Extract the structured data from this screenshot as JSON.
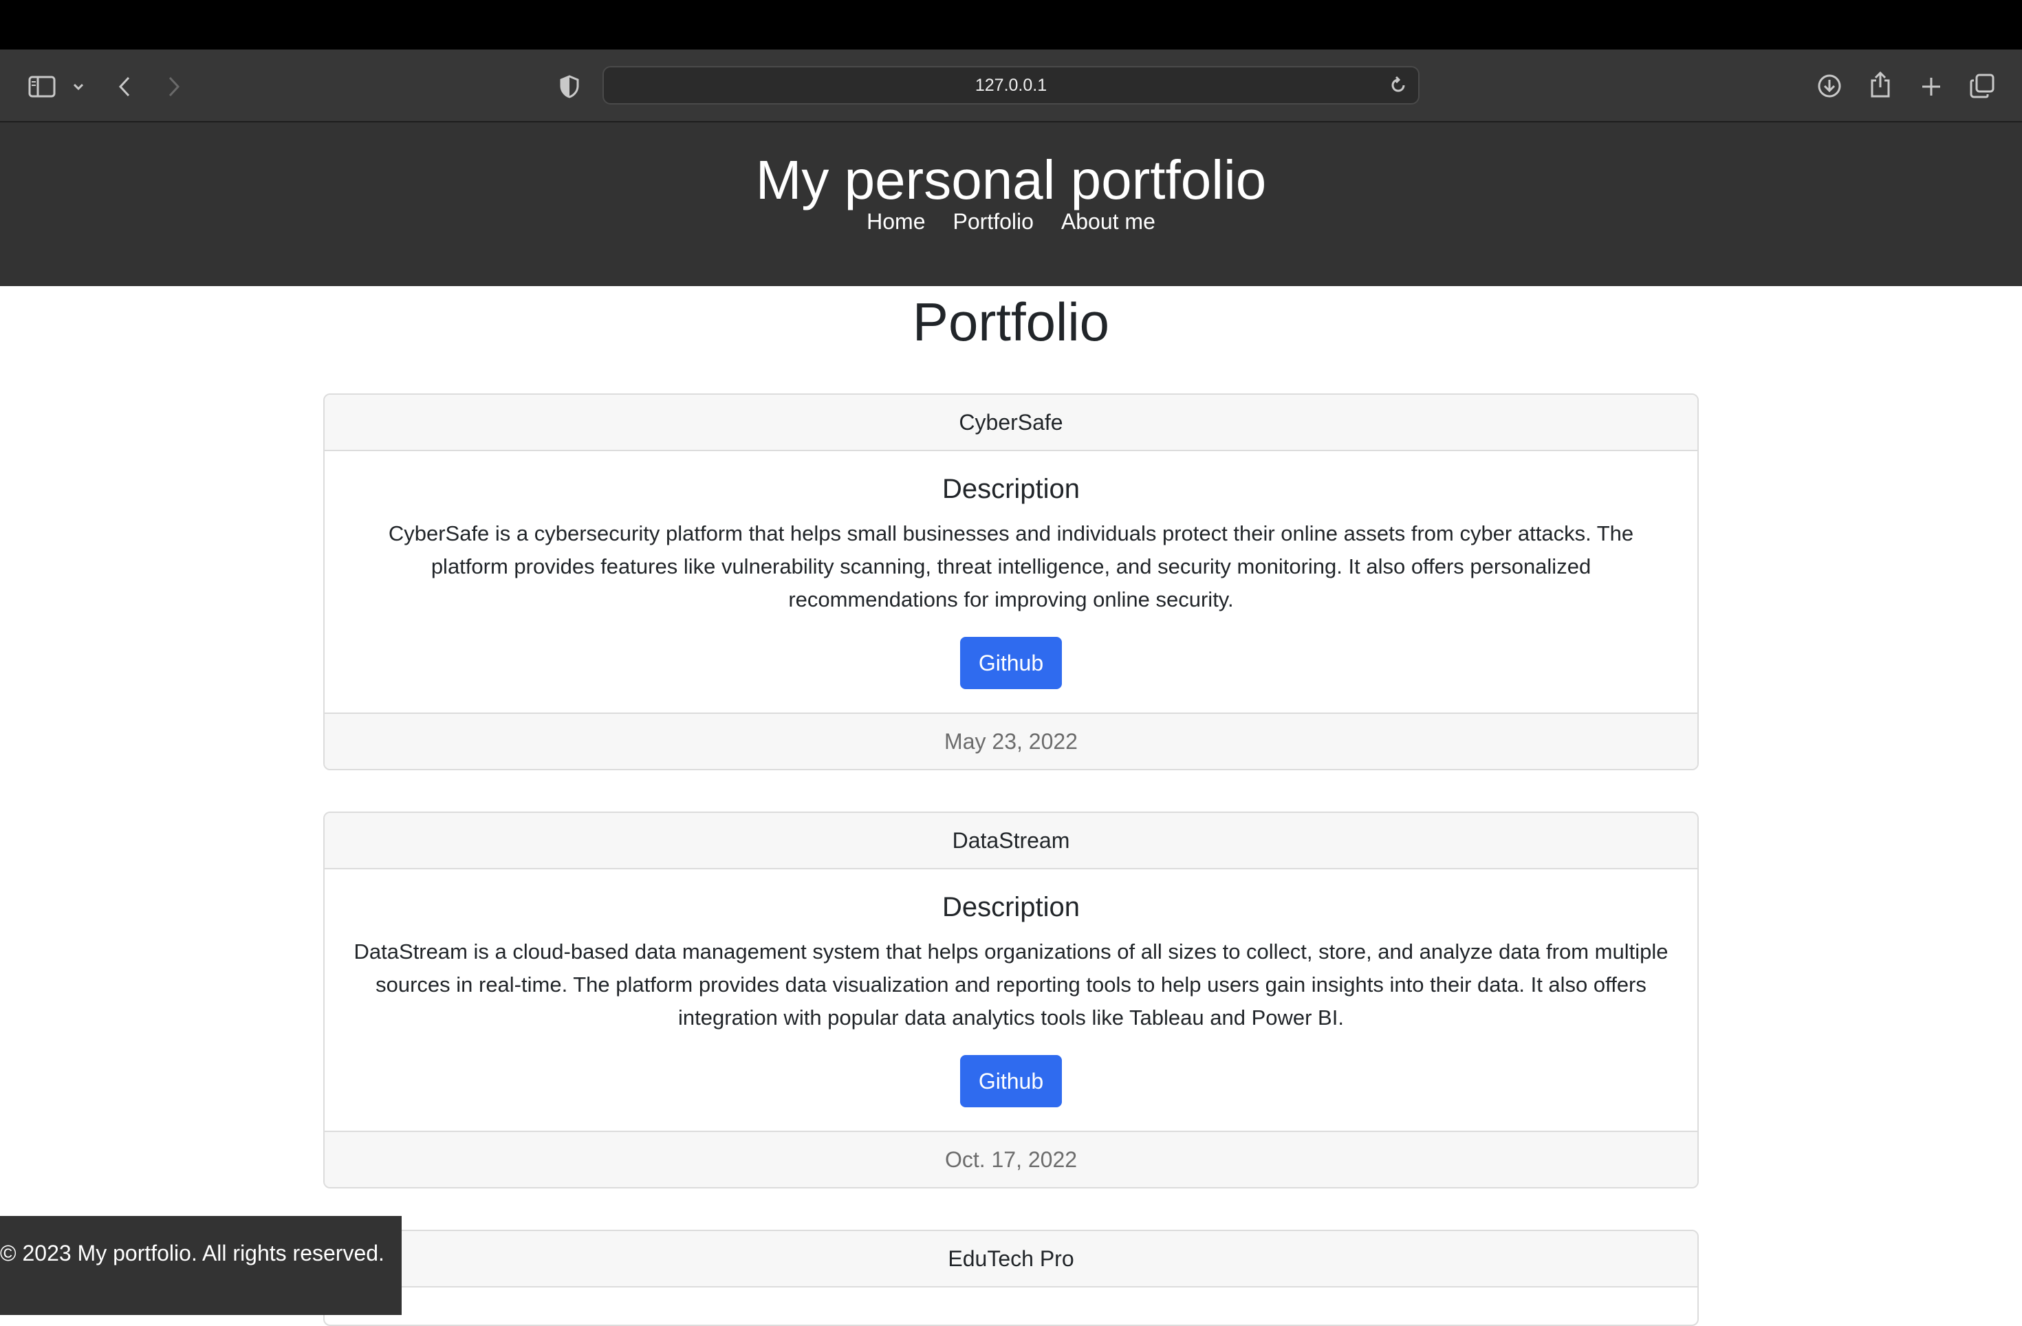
{
  "browser": {
    "url": "127.0.0.1"
  },
  "header": {
    "title": "My personal portfolio",
    "nav": [
      "Home",
      "Portfolio",
      "About me"
    ]
  },
  "main": {
    "heading": "Portfolio",
    "projects": [
      {
        "name": "CyberSafe",
        "description_heading": "Description",
        "description": "CyberSafe is a cybersecurity platform that helps small businesses and individuals protect their online assets from cyber attacks. The platform provides features like vulnerability scanning, threat intelligence, and security monitoring. It also offers personalized recommendations for improving online security.",
        "button_label": "Github",
        "date": "May 23, 2022"
      },
      {
        "name": "DataStream",
        "description_heading": "Description",
        "description": "DataStream is a cloud-based data management system that helps organizations of all sizes to collect, store, and analyze data from multiple sources in real-time. The platform provides data visualization and reporting tools to help users gain insights into their data. It also offers integration with popular data analytics tools like Tableau and Power BI.",
        "button_label": "Github",
        "date": "Oct. 17, 2022"
      },
      {
        "name": "EduTech Pro"
      }
    ]
  },
  "footer": {
    "text": "© 2023 My portfolio. All rights reserved."
  },
  "colors": {
    "header_bg": "#333333",
    "button_bg": "#2f6bef",
    "card_header_bg": "#f7f7f7"
  }
}
